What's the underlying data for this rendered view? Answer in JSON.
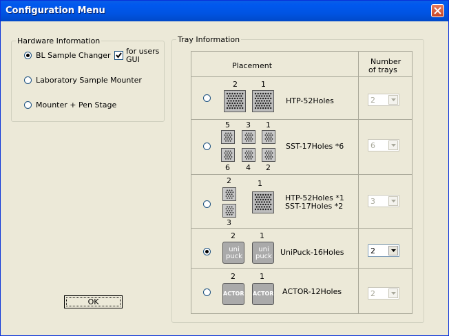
{
  "window": {
    "title": "Configuration Menu"
  },
  "hardware": {
    "legend": "Hardware Information",
    "options": [
      {
        "label": "BL Sample Changer",
        "selected": true
      },
      {
        "label": "Laboratory Sample Mounter",
        "selected": false
      },
      {
        "label": "Mounter + Pen Stage",
        "selected": false
      }
    ],
    "for_users": {
      "line1": "for users",
      "line2": "GUI",
      "checked": true
    }
  },
  "ok_label": "OK",
  "tray": {
    "legend": "Tray Information",
    "header_placement": "Placement",
    "header_number_line1": "Number",
    "header_number_line2": "of trays",
    "rows": [
      {
        "label": "HTP-52Holes",
        "nums": [
          "2",
          "1"
        ],
        "count": "2",
        "enabled": false,
        "selected": false
      },
      {
        "label": "SST-17Holes *6",
        "nums_top": [
          "5",
          "3",
          "1"
        ],
        "nums_bottom": [
          "6",
          "4",
          "2"
        ],
        "count": "6",
        "enabled": false,
        "selected": false
      },
      {
        "label_line1": "HTP-52Holes *1",
        "label_line2": "SST-17Holes *2",
        "nums": [
          "2",
          "1",
          "3"
        ],
        "count": "3",
        "enabled": false,
        "selected": false
      },
      {
        "label": "UniPuck-16Holes",
        "nums": [
          "2",
          "1"
        ],
        "count": "2",
        "enabled": true,
        "selected": true,
        "icon_line1": "uni",
        "icon_line2": "puck"
      },
      {
        "label": "ACTOR-12Holes",
        "nums": [
          "2",
          "1"
        ],
        "count": "2",
        "enabled": false,
        "selected": false,
        "icon_text": "ACTOR"
      }
    ]
  }
}
